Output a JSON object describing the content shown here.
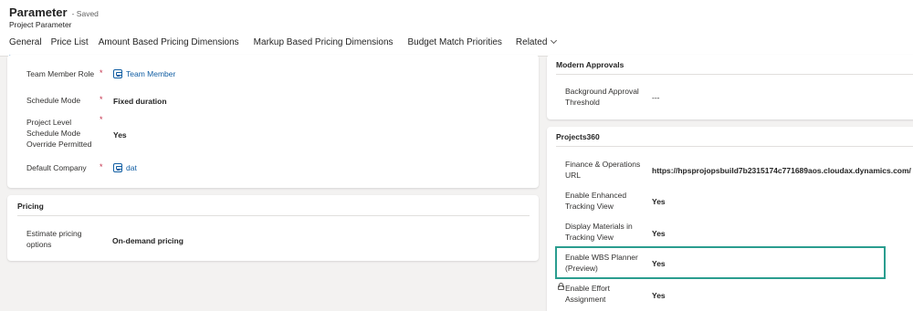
{
  "header": {
    "title": "Parameter",
    "saved_status": "- Saved",
    "subtitle": "Project Parameter"
  },
  "tabs": [
    {
      "label": "General",
      "active": true
    },
    {
      "label": "Price List"
    },
    {
      "label": "Amount Based Pricing Dimensions"
    },
    {
      "label": "Markup Based Pricing Dimensions"
    },
    {
      "label": "Budget Match Priorities"
    },
    {
      "label": "Related"
    }
  ],
  "left_card": {
    "fields": [
      {
        "label": "Team Member Role",
        "required": "*",
        "value": "Team Member"
      },
      {
        "label": "Schedule Mode",
        "required": "*",
        "value": "Fixed duration"
      },
      {
        "label_lines": [
          "Project Level",
          "Schedule Mode",
          "Override Permitted"
        ],
        "required": "*",
        "value": "Yes"
      },
      {
        "label": "Default Company",
        "required": "*",
        "value": "dat"
      }
    ]
  },
  "pricing": {
    "title": "Pricing",
    "label_lines": [
      "Estimate pricing",
      "options"
    ],
    "value": "On-demand pricing"
  },
  "modern_approvals": {
    "title": "Modern Approvals",
    "label_lines": [
      "Background Approval",
      "Threshold"
    ],
    "value": "---"
  },
  "projects360": {
    "title": "Projects360",
    "fields": [
      {
        "label_lines": [
          "Finance & Operations",
          "URL"
        ],
        "value": "https://hpsprojopsbuild7b2315174c771689aos.cloudax.dynamics.com/"
      },
      {
        "label_lines": [
          "Enable Enhanced",
          "Tracking View"
        ],
        "value": "Yes"
      },
      {
        "label_lines": [
          "Display Materials in",
          "Tracking View"
        ],
        "value": "Yes"
      },
      {
        "label_lines": [
          "Enable WBS Planner",
          "(Preview)"
        ],
        "value": "Yes"
      },
      {
        "label_lines": [
          "Enable Effort",
          "Assignment"
        ],
        "value": "Yes"
      }
    ]
  },
  "colors": {
    "accent": "#0f6cbd",
    "link": "#115ea3",
    "required": "#c4314b",
    "highlight_border": "#2a9d8f"
  },
  "icons": {
    "lookup": "entity-record-icon",
    "locked": "lock-icon",
    "related_menu": "chevron-down-icon"
  }
}
